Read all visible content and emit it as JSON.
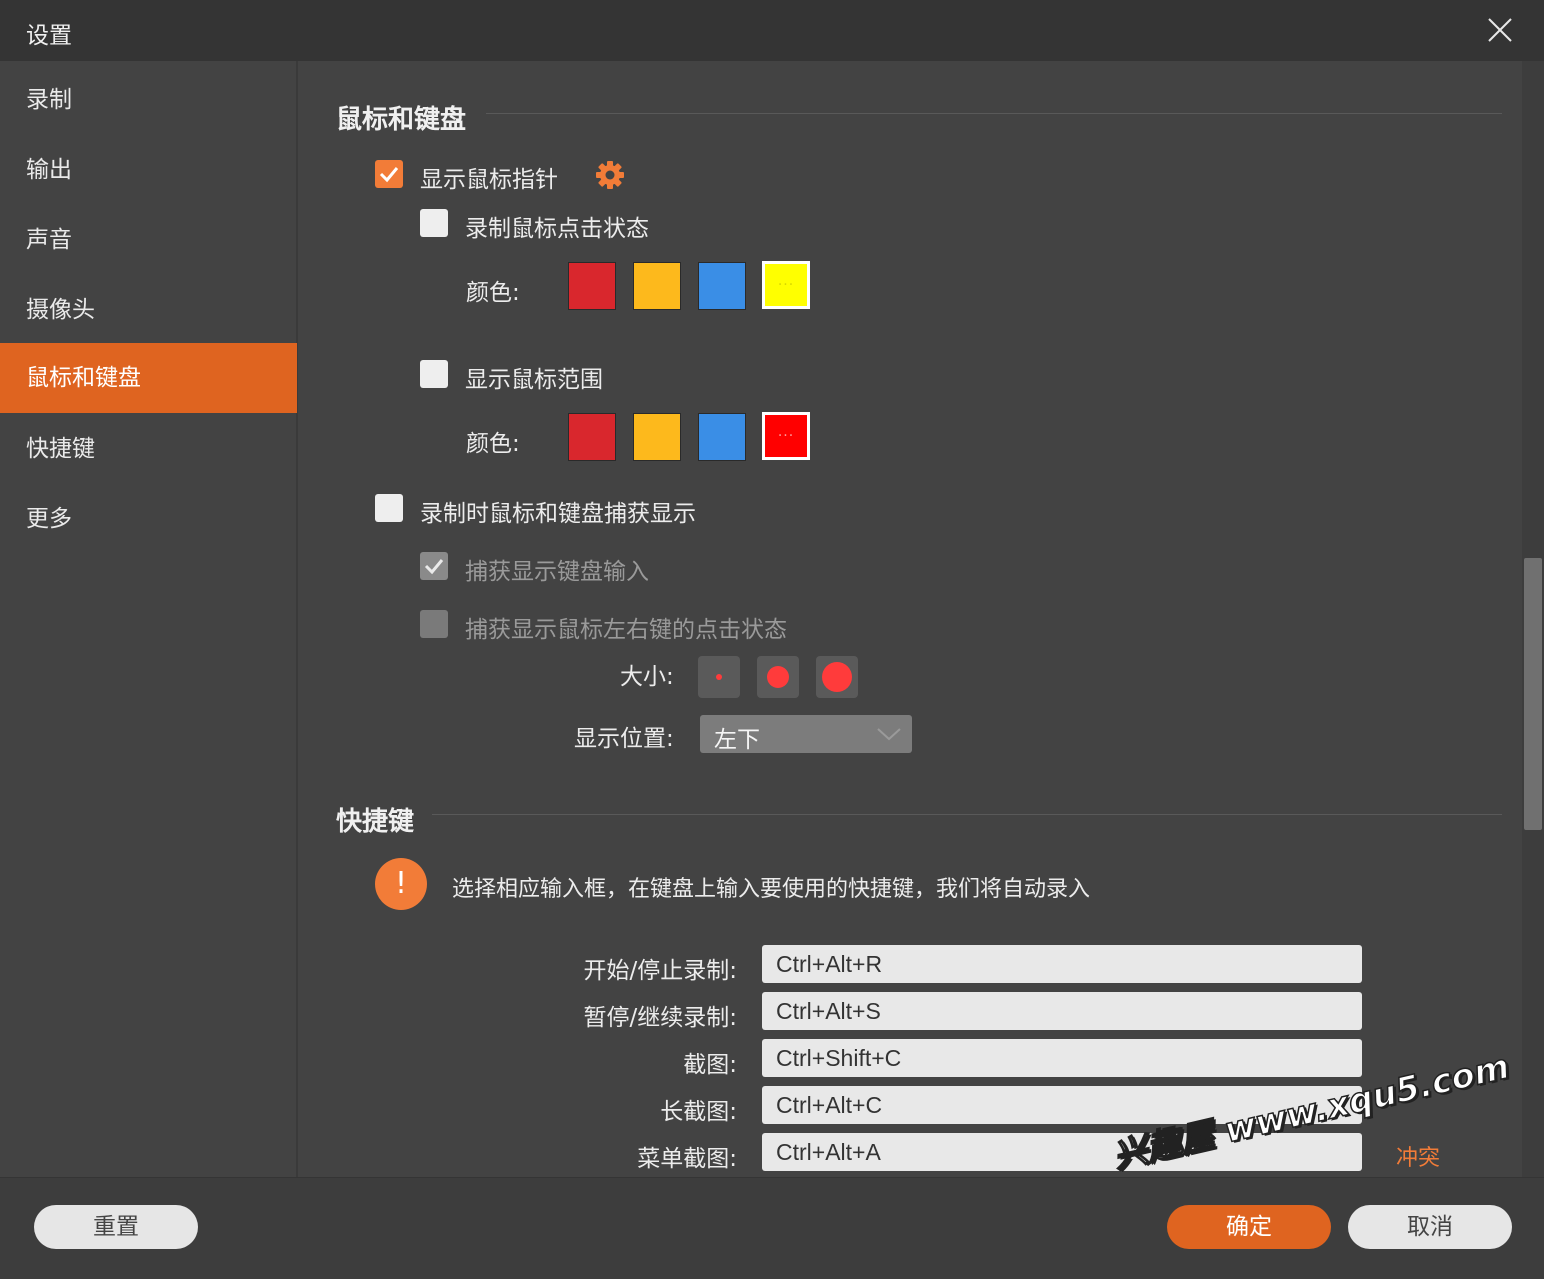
{
  "window": {
    "title": "设置"
  },
  "sidebar": {
    "items": [
      {
        "label": "录制"
      },
      {
        "label": "输出"
      },
      {
        "label": "声音"
      },
      {
        "label": "摄像头"
      },
      {
        "label": "鼠标和键盘",
        "active": true
      },
      {
        "label": "快捷键"
      },
      {
        "label": "更多"
      }
    ]
  },
  "mouse_keyboard": {
    "title": "鼠标和键盘",
    "show_pointer": {
      "label": "显示鼠标指针",
      "checked": true
    },
    "record_click": {
      "label": "录制鼠标点击状态",
      "checked": false
    },
    "click_colors": {
      "label": "颜色:",
      "swatches": [
        "#d9272d",
        "#fdb91c",
        "#3a8ee6",
        "#ffff00"
      ],
      "selected_index": 3
    },
    "show_range": {
      "label": "显示鼠标范围",
      "checked": false
    },
    "range_colors": {
      "label": "颜色:",
      "swatches": [
        "#d9272d",
        "#fdb91c",
        "#3a8ee6",
        "#ff0000"
      ],
      "selected_index": 3
    },
    "capture_display": {
      "label": "录制时鼠标和键盘捕获显示",
      "checked": false
    },
    "capture_keyboard": {
      "label": "捕获显示键盘输入",
      "checked": true,
      "disabled": true
    },
    "capture_mouse_buttons": {
      "label": "捕获显示鼠标左右键的点击状态",
      "checked": false,
      "disabled": true
    },
    "size": {
      "label": "大小:"
    },
    "position": {
      "label": "显示位置:",
      "value": "左下"
    }
  },
  "hotkeys": {
    "title": "快捷键",
    "hint": "选择相应输入框，在键盘上输入要使用的快捷键，我们将自动录入",
    "rows": [
      {
        "label": "开始/停止录制:",
        "value": "Ctrl+Alt+R"
      },
      {
        "label": "暂停/继续录制:",
        "value": "Ctrl+Alt+S"
      },
      {
        "label": "截图:",
        "value": "Ctrl+Shift+C"
      },
      {
        "label": "长截图:",
        "value": "Ctrl+Alt+C"
      },
      {
        "label": "菜单截图:",
        "value": "Ctrl+Alt+A"
      }
    ],
    "conflict": "冲突"
  },
  "footer": {
    "reset": "重置",
    "ok": "确定",
    "cancel": "取消"
  },
  "watermark": "兴趣屋 www.xqu5.com",
  "colors": {
    "accent": "#df6420",
    "checkbox_checked": "#f27c38",
    "background": "#434343",
    "titlebar": "#343434"
  }
}
